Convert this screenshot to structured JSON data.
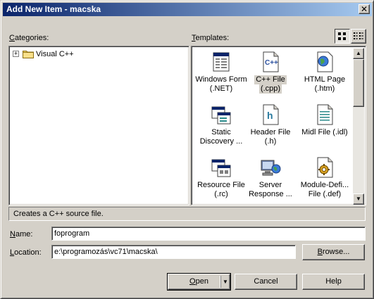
{
  "window": {
    "title": "Add New Item - macska",
    "close_glyph": "✕"
  },
  "categories": {
    "label_accel": "C",
    "label_rest": "ategories:",
    "items": [
      {
        "label": "Visual C++",
        "expander": "+"
      }
    ]
  },
  "templates": {
    "label_accel": "T",
    "label_rest": "emplates:",
    "items": [
      {
        "line1": "Windows Form",
        "line2": "(.NET)",
        "icon": "windows-form-icon"
      },
      {
        "line1": "C++ File",
        "line2": "(.cpp)",
        "icon": "cpp-file-icon",
        "selected": true
      },
      {
        "line1": "HTML Page",
        "line2": "(.htm)",
        "icon": "html-page-icon"
      },
      {
        "line1": "Static",
        "line2": "Discovery ...",
        "icon": "static-discovery-icon"
      },
      {
        "line1": "Header File",
        "line2": "(.h)",
        "icon": "header-file-icon"
      },
      {
        "line1": "Midl File (.idl)",
        "line2": "",
        "icon": "midl-file-icon"
      },
      {
        "line1": "Resource File",
        "line2": "(.rc)",
        "icon": "resource-file-icon"
      },
      {
        "line1": "Server",
        "line2": "Response ...",
        "icon": "server-response-icon"
      },
      {
        "line1": "Module-Defi...",
        "line2": "File (.def)",
        "icon": "module-definition-icon"
      }
    ]
  },
  "description": "Creates a C++ source file.",
  "name": {
    "label_accel": "N",
    "label_rest": "ame:",
    "value": "foprogram"
  },
  "location": {
    "label_accel": "L",
    "label_rest": "ocation:",
    "value": "e:\\programozás\\vc71\\macska\\"
  },
  "buttons": {
    "browse_accel": "B",
    "browse_rest": "rowse...",
    "open_accel": "O",
    "open_rest": "pen",
    "open_arrow": "▼",
    "cancel": "Cancel",
    "help": "Help"
  },
  "scrollbar": {
    "up": "▲",
    "down": "▼"
  }
}
